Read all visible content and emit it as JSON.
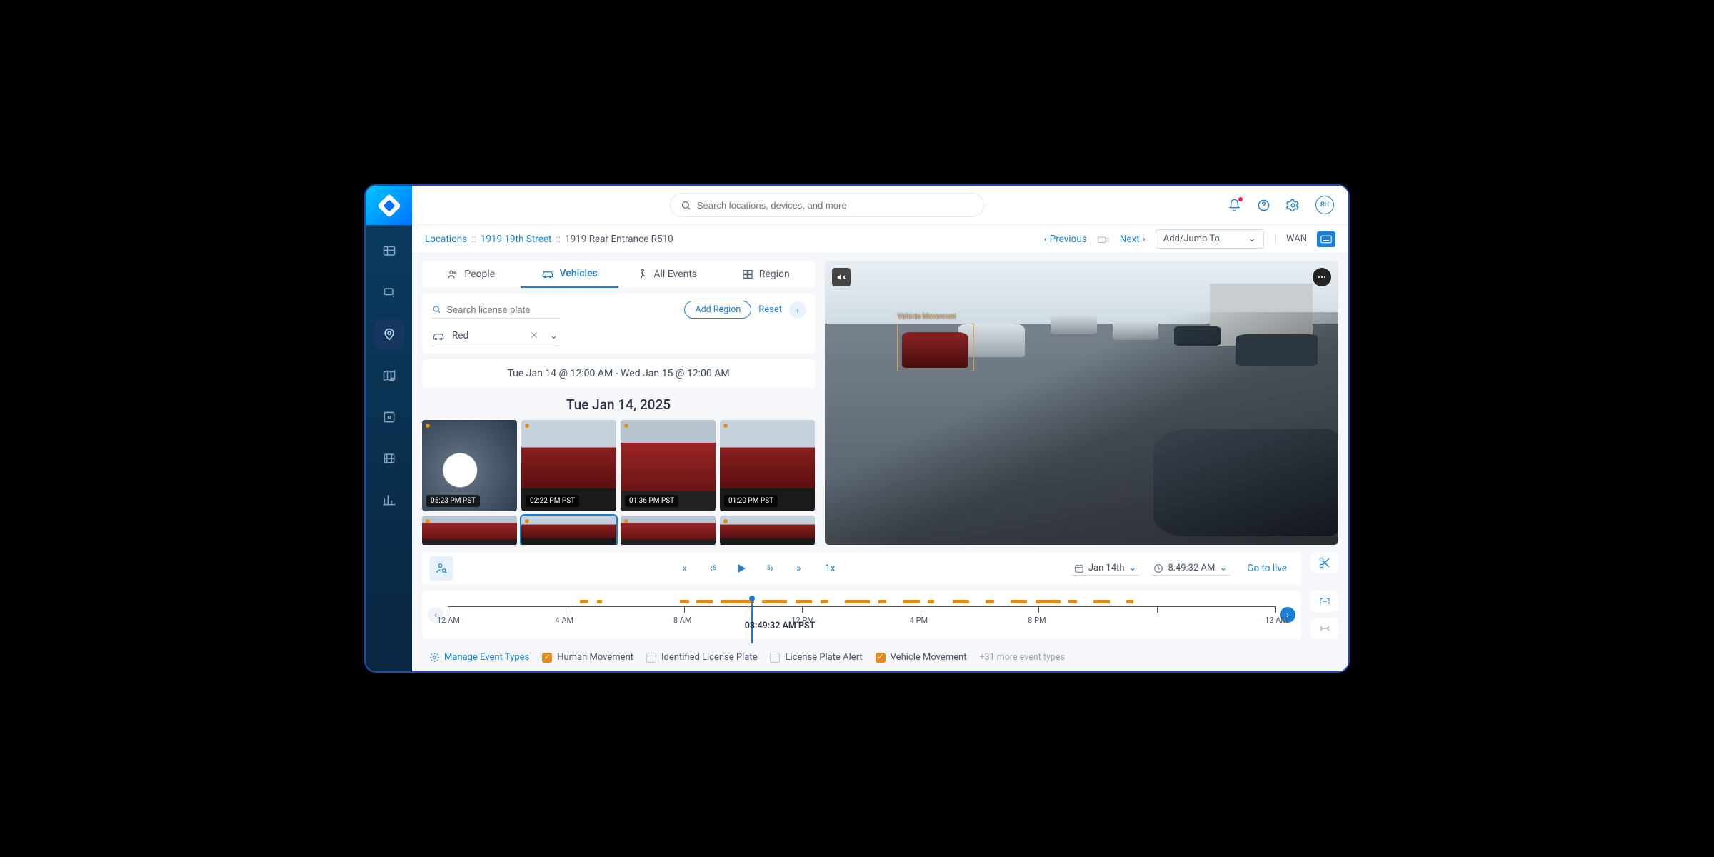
{
  "search": {
    "placeholder": "Search locations, devices, and more"
  },
  "avatar_initials": "RH",
  "breadcrumb": {
    "root": "Locations",
    "mid": "1919 19th Street",
    "current": "1919 Rear Entrance R510",
    "prev": "Previous",
    "next": "Next",
    "jump": "Add/Jump To",
    "wan": "WAN"
  },
  "tabs": {
    "people": "People",
    "vehicles": "Vehicles",
    "all_events": "All Events",
    "region": "Region"
  },
  "filters": {
    "plate_placeholder": "Search license plate",
    "add_region": "Add Region",
    "reset": "Reset",
    "color_value": "Red"
  },
  "date_range": "Tue Jan 14 @ 12:00 AM - Wed Jan 15 @ 12:00 AM",
  "date_heading": "Tue Jan 14, 2025",
  "thumbs": [
    {
      "time": "05:23 PM PST"
    },
    {
      "time": "02:22 PM PST"
    },
    {
      "time": "01:36 PM PST"
    },
    {
      "time": "01:20 PM PST"
    }
  ],
  "video": {
    "detection_label": "Vehicle Movement"
  },
  "controls": {
    "speed": "1x",
    "date": "Jan 14th",
    "time": "8:49:32 AM",
    "go_live": "Go to live"
  },
  "timeline": {
    "labels": [
      "12 AM",
      "4 AM",
      "8 AM",
      "12 PM",
      "4 PM",
      "8 PM",
      "12 AM"
    ],
    "cursor_label": "08:49:32 AM PST"
  },
  "event_types": {
    "manage": "Manage Event Types",
    "human": "Human Movement",
    "plate_id": "Identified License Plate",
    "plate_alert": "License Plate Alert",
    "vehicle": "Vehicle Movement",
    "more": "+31 more event types"
  }
}
